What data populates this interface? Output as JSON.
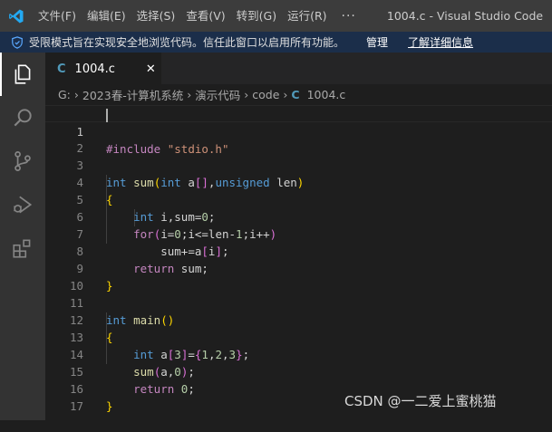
{
  "titlebar": {
    "menu": [
      "文件(F)",
      "编辑(E)",
      "选择(S)",
      "查看(V)",
      "转到(G)",
      "运行(R)"
    ],
    "more": "···",
    "window_title": "1004.c - Visual Studio Code"
  },
  "banner": {
    "message": "受限模式旨在实现安全地浏览代码。信任此窗口以启用所有功能。",
    "manage": "管理",
    "learn_more": "了解详细信息"
  },
  "activity_bar": {
    "items": [
      "explorer-icon",
      "search-icon",
      "source-control-icon",
      "run-debug-icon",
      "extensions-icon"
    ]
  },
  "tab": {
    "icon_label": "C",
    "label": "1004.c",
    "close": "✕"
  },
  "breadcrumb": {
    "items": [
      "G:",
      "2023春-计算机系统",
      "演示代码",
      "code"
    ],
    "file_icon": "C",
    "file": "1004.c"
  },
  "editor": {
    "line_numbers": [
      "1",
      "2",
      "3",
      "4",
      "5",
      "6",
      "7",
      "8",
      "9",
      "10",
      "11",
      "12",
      "13",
      "14",
      "15",
      "16",
      "17"
    ],
    "lines": [
      "#include \"stdio.h\"",
      "",
      "int sum(int a[],unsigned len)",
      "{",
      "    int i,sum=0;",
      "    for(i=0;i<=len-1;i++)",
      "        sum+=a[i];",
      "    return sum;",
      "}",
      "",
      "int main()",
      "{",
      "    int a[3]={1,2,3};",
      "    sum(a,0);",
      "    return 0;",
      "}",
      ""
    ]
  },
  "watermark": "CSDN @一二爱上蜜桃猫",
  "colors": {
    "keyword": "#569cd6",
    "function": "#dcdcaa",
    "string": "#ce9178",
    "number": "#b5cea8",
    "preprocessor": "#c586c0",
    "bracket_1": "#ffd700",
    "bracket_2": "#da70d6",
    "title_bar": "#3c3c3c",
    "banner": "#1b2e4a",
    "activity_bar": "#333333",
    "editor": "#1e1e1e"
  }
}
